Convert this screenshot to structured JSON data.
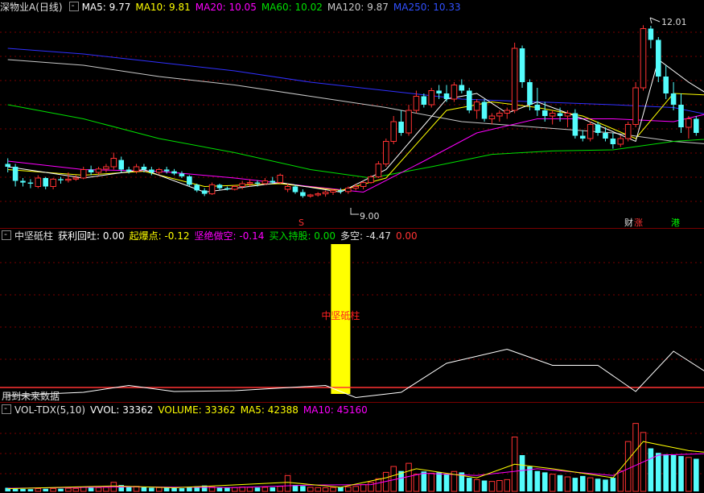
{
  "header_main": {
    "title": "深物业A(日线)",
    "ma5_label": "MA5: 9.77",
    "ma10_label": "MA10: 9.81",
    "ma20_label": "MA20: 10.05",
    "ma60_label": "MA60: 10.02",
    "ma120_label": "MA120: 9.87",
    "ma250_label": "MA250: 10.33"
  },
  "header_indicator": {
    "title": "中坚砥柱",
    "profit_label": "获利回吐: 0.00",
    "start_label": "起爆点: -0.12",
    "short_label": "坚绝做空: -0.14",
    "hold_label": "买入持股: 0.00",
    "longshort_label": "多空: -4.47",
    "extra_label": "0.00"
  },
  "header_volume": {
    "title": "VOL-TDX(5,10)",
    "vvol_label": "VVOL: 33362",
    "volume_label": "VOLUME: 33362",
    "ma5_label": "MA5: 42388",
    "ma10_label": "MA10: 45160"
  },
  "annotations": {
    "high_price": "12.01",
    "low_price": "9.00",
    "bar_label": "中坚砥柱",
    "future_note": "用到未来数据",
    "event_cai": "财",
    "event_zhang": "涨",
    "event_gang": "港",
    "event_s": "S"
  },
  "colors": {
    "up": "#ff3232",
    "down": "#54fcfc",
    "ma5": "#ffffff",
    "ma10": "#ffff00",
    "ma20": "#ff00ff",
    "ma60": "#00e000",
    "ma120": "#c8c8c8",
    "ma250": "#3030ff",
    "highlight": "#ffff00"
  },
  "chart_data": [
    {
      "type": "candlestick",
      "price_range": [
        8.6,
        12.2
      ],
      "candles": [
        {
          "o": 9.55,
          "h": 9.65,
          "l": 9.4,
          "c": 9.5
        },
        {
          "o": 9.5,
          "h": 9.55,
          "l": 9.15,
          "c": 9.25
        },
        {
          "o": 9.25,
          "h": 9.3,
          "l": 9.15,
          "c": 9.22
        },
        {
          "o": 9.22,
          "h": 9.28,
          "l": 9.12,
          "c": 9.2
        },
        {
          "o": 9.15,
          "h": 9.35,
          "l": 9.12,
          "c": 9.3
        },
        {
          "o": 9.3,
          "h": 9.32,
          "l": 9.1,
          "c": 9.15
        },
        {
          "o": 9.15,
          "h": 9.3,
          "l": 9.1,
          "c": 9.28
        },
        {
          "o": 9.28,
          "h": 9.32,
          "l": 9.2,
          "c": 9.26
        },
        {
          "o": 9.26,
          "h": 9.4,
          "l": 9.22,
          "c": 9.28
        },
        {
          "o": 9.28,
          "h": 9.35,
          "l": 9.25,
          "c": 9.3
        },
        {
          "o": 9.3,
          "h": 9.5,
          "l": 9.28,
          "c": 9.45
        },
        {
          "o": 9.45,
          "h": 9.52,
          "l": 9.35,
          "c": 9.4
        },
        {
          "o": 9.4,
          "h": 9.5,
          "l": 9.35,
          "c": 9.46
        },
        {
          "o": 9.46,
          "h": 9.55,
          "l": 9.4,
          "c": 9.5
        },
        {
          "o": 9.5,
          "h": 9.75,
          "l": 9.45,
          "c": 9.65
        },
        {
          "o": 9.62,
          "h": 9.68,
          "l": 9.4,
          "c": 9.45
        },
        {
          "o": 9.45,
          "h": 9.5,
          "l": 9.38,
          "c": 9.42
        },
        {
          "o": 9.42,
          "h": 9.55,
          "l": 9.38,
          "c": 9.5
        },
        {
          "o": 9.5,
          "h": 9.55,
          "l": 9.4,
          "c": 9.45
        },
        {
          "o": 9.45,
          "h": 9.5,
          "l": 9.35,
          "c": 9.4
        },
        {
          "o": 9.4,
          "h": 9.48,
          "l": 9.36,
          "c": 9.45
        },
        {
          "o": 9.45,
          "h": 9.5,
          "l": 9.38,
          "c": 9.42
        },
        {
          "o": 9.42,
          "h": 9.46,
          "l": 9.35,
          "c": 9.38
        },
        {
          "o": 9.38,
          "h": 9.42,
          "l": 9.3,
          "c": 9.33
        },
        {
          "o": 9.33,
          "h": 9.35,
          "l": 9.15,
          "c": 9.18
        },
        {
          "o": 9.18,
          "h": 9.2,
          "l": 9.05,
          "c": 9.08
        },
        {
          "o": 9.08,
          "h": 9.12,
          "l": 8.98,
          "c": 9.02
        },
        {
          "o": 9.02,
          "h": 9.22,
          "l": 9.0,
          "c": 9.18
        },
        {
          "o": 9.18,
          "h": 9.2,
          "l": 9.08,
          "c": 9.12
        },
        {
          "o": 9.12,
          "h": 9.15,
          "l": 9.08,
          "c": 9.1
        },
        {
          "o": 9.1,
          "h": 9.18,
          "l": 9.08,
          "c": 9.15
        },
        {
          "o": 9.15,
          "h": 9.25,
          "l": 9.1,
          "c": 9.2
        },
        {
          "o": 9.2,
          "h": 9.28,
          "l": 9.15,
          "c": 9.22
        },
        {
          "o": 9.22,
          "h": 9.26,
          "l": 9.15,
          "c": 9.2
        },
        {
          "o": 9.2,
          "h": 9.3,
          "l": 9.18,
          "c": 9.25
        },
        {
          "o": 9.25,
          "h": 9.32,
          "l": 9.2,
          "c": 9.22
        },
        {
          "o": 9.22,
          "h": 9.38,
          "l": 9.2,
          "c": 9.35
        },
        {
          "o": 9.1,
          "h": 9.2,
          "l": 9.05,
          "c": 9.15
        },
        {
          "o": 9.15,
          "h": 9.18,
          "l": 9.02,
          "c": 9.05
        },
        {
          "o": 9.05,
          "h": 9.1,
          "l": 8.95,
          "c": 8.98
        },
        {
          "o": 8.98,
          "h": 9.02,
          "l": 8.95,
          "c": 9.0
        },
        {
          "o": 9.0,
          "h": 9.05,
          "l": 8.97,
          "c": 9.02
        },
        {
          "o": 9.02,
          "h": 9.08,
          "l": 8.97,
          "c": 9.05
        },
        {
          "o": 9.05,
          "h": 9.1,
          "l": 9.0,
          "c": 9.08
        },
        {
          "o": 9.08,
          "h": 9.12,
          "l": 9.02,
          "c": 9.06
        },
        {
          "o": 9.06,
          "h": 9.15,
          "l": 9.02,
          "c": 9.12
        },
        {
          "o": 9.12,
          "h": 9.2,
          "l": 9.08,
          "c": 9.15
        },
        {
          "o": 9.15,
          "h": 9.25,
          "l": 9.1,
          "c": 9.22
        },
        {
          "o": 9.22,
          "h": 9.35,
          "l": 9.2,
          "c": 9.32
        },
        {
          "o": 9.32,
          "h": 9.6,
          "l": 9.3,
          "c": 9.55
        },
        {
          "o": 9.55,
          "h": 10.0,
          "l": 9.5,
          "c": 9.95
        },
        {
          "o": 9.95,
          "h": 10.4,
          "l": 9.9,
          "c": 10.3
        },
        {
          "o": 10.3,
          "h": 10.5,
          "l": 10.05,
          "c": 10.1
        },
        {
          "o": 10.1,
          "h": 10.6,
          "l": 10.05,
          "c": 10.5
        },
        {
          "o": 10.5,
          "h": 10.85,
          "l": 10.45,
          "c": 10.75
        },
        {
          "o": 10.75,
          "h": 10.8,
          "l": 10.55,
          "c": 10.6
        },
        {
          "o": 10.6,
          "h": 10.9,
          "l": 10.55,
          "c": 10.85
        },
        {
          "o": 10.85,
          "h": 10.95,
          "l": 10.7,
          "c": 10.8
        },
        {
          "o": 10.8,
          "h": 10.95,
          "l": 10.65,
          "c": 10.7
        },
        {
          "o": 10.7,
          "h": 11.0,
          "l": 10.65,
          "c": 10.95
        },
        {
          "o": 10.95,
          "h": 11.05,
          "l": 10.8,
          "c": 10.85
        },
        {
          "o": 10.85,
          "h": 10.9,
          "l": 10.45,
          "c": 10.5
        },
        {
          "o": 10.5,
          "h": 10.7,
          "l": 10.35,
          "c": 10.65
        },
        {
          "o": 10.65,
          "h": 10.7,
          "l": 10.3,
          "c": 10.35
        },
        {
          "o": 10.35,
          "h": 10.45,
          "l": 10.25,
          "c": 10.4
        },
        {
          "o": 10.4,
          "h": 10.5,
          "l": 10.3,
          "c": 10.45
        },
        {
          "o": 10.45,
          "h": 10.55,
          "l": 10.35,
          "c": 10.5
        },
        {
          "o": 10.5,
          "h": 11.7,
          "l": 10.45,
          "c": 11.6
        },
        {
          "o": 11.6,
          "h": 11.65,
          "l": 10.9,
          "c": 11.0
        },
        {
          "o": 11.0,
          "h": 11.05,
          "l": 10.5,
          "c": 10.6
        },
        {
          "o": 10.6,
          "h": 10.9,
          "l": 10.4,
          "c": 10.5
        },
        {
          "o": 10.5,
          "h": 10.65,
          "l": 10.3,
          "c": 10.4
        },
        {
          "o": 10.4,
          "h": 10.5,
          "l": 10.25,
          "c": 10.45
        },
        {
          "o": 10.45,
          "h": 10.55,
          "l": 10.3,
          "c": 10.4
        },
        {
          "o": 10.4,
          "h": 10.5,
          "l": 10.2,
          "c": 10.45
        },
        {
          "o": 10.45,
          "h": 10.52,
          "l": 10.0,
          "c": 10.05
        },
        {
          "o": 10.05,
          "h": 10.15,
          "l": 9.95,
          "c": 10.0
        },
        {
          "o": 10.0,
          "h": 10.3,
          "l": 9.95,
          "c": 10.25
        },
        {
          "o": 10.25,
          "h": 10.3,
          "l": 10.05,
          "c": 10.1
        },
        {
          "o": 10.1,
          "h": 10.2,
          "l": 9.95,
          "c": 10.0
        },
        {
          "o": 10.0,
          "h": 10.1,
          "l": 9.82,
          "c": 9.9
        },
        {
          "o": 9.9,
          "h": 10.05,
          "l": 9.85,
          "c": 10.0
        },
        {
          "o": 10.0,
          "h": 10.3,
          "l": 9.95,
          "c": 10.25
        },
        {
          "o": 10.25,
          "h": 11.0,
          "l": 10.2,
          "c": 10.9
        },
        {
          "o": 10.9,
          "h": 12.01,
          "l": 10.85,
          "c": 11.95
        },
        {
          "o": 11.95,
          "h": 12.0,
          "l": 11.6,
          "c": 11.75
        },
        {
          "o": 11.75,
          "h": 11.8,
          "l": 11.0,
          "c": 11.1
        },
        {
          "o": 11.1,
          "h": 11.3,
          "l": 10.7,
          "c": 10.8
        },
        {
          "o": 10.8,
          "h": 11.0,
          "l": 10.5,
          "c": 10.6
        },
        {
          "o": 10.6,
          "h": 10.8,
          "l": 10.1,
          "c": 10.2
        },
        {
          "o": 10.2,
          "h": 10.4,
          "l": 10.0,
          "c": 10.35
        },
        {
          "o": 10.35,
          "h": 10.4,
          "l": 10.05,
          "c": 10.1
        }
      ],
      "moving_averages": {
        "ma5": [
          [
            0,
            9.5
          ],
          [
            10,
            9.3
          ],
          [
            18,
            9.45
          ],
          [
            26,
            9.05
          ],
          [
            36,
            9.22
          ],
          [
            44,
            9.05
          ],
          [
            50,
            9.45
          ],
          [
            58,
            10.7
          ],
          [
            62,
            10.8
          ],
          [
            66,
            10.45
          ],
          [
            70,
            10.65
          ],
          [
            76,
            10.35
          ],
          [
            83,
            9.95
          ],
          [
            86,
            11.4
          ],
          [
            90,
            11.0
          ],
          [
            96,
            10.5
          ]
        ],
        "ma10": [
          [
            0,
            9.45
          ],
          [
            10,
            9.35
          ],
          [
            18,
            9.42
          ],
          [
            26,
            9.15
          ],
          [
            36,
            9.2
          ],
          [
            44,
            9.08
          ],
          [
            50,
            9.3
          ],
          [
            58,
            10.5
          ],
          [
            64,
            10.65
          ],
          [
            70,
            10.55
          ],
          [
            76,
            10.4
          ],
          [
            83,
            10.0
          ],
          [
            88,
            10.8
          ],
          [
            96,
            10.75
          ]
        ],
        "ma20": [
          [
            0,
            9.6
          ],
          [
            10,
            9.45
          ],
          [
            20,
            9.42
          ],
          [
            30,
            9.3
          ],
          [
            40,
            9.15
          ],
          [
            47,
            9.05
          ],
          [
            55,
            9.6
          ],
          [
            62,
            10.1
          ],
          [
            70,
            10.35
          ],
          [
            80,
            10.35
          ],
          [
            88,
            10.3
          ],
          [
            96,
            10.55
          ]
        ],
        "ma60": [
          [
            0,
            10.6
          ],
          [
            10,
            10.35
          ],
          [
            20,
            10.0
          ],
          [
            30,
            9.75
          ],
          [
            40,
            9.45
          ],
          [
            48,
            9.3
          ],
          [
            56,
            9.5
          ],
          [
            64,
            9.72
          ],
          [
            72,
            9.78
          ],
          [
            80,
            9.8
          ],
          [
            88,
            9.95
          ],
          [
            96,
            10.02
          ]
        ],
        "ma120": [
          [
            0,
            11.4
          ],
          [
            10,
            11.3
          ],
          [
            20,
            11.1
          ],
          [
            30,
            10.95
          ],
          [
            40,
            10.75
          ],
          [
            50,
            10.55
          ],
          [
            60,
            10.3
          ],
          [
            70,
            10.2
          ],
          [
            80,
            10.1
          ],
          [
            88,
            9.95
          ],
          [
            96,
            9.87
          ]
        ],
        "ma250": [
          [
            0,
            11.6
          ],
          [
            10,
            11.5
          ],
          [
            20,
            11.35
          ],
          [
            30,
            11.2
          ],
          [
            40,
            11.0
          ],
          [
            50,
            10.85
          ],
          [
            60,
            10.7
          ],
          [
            70,
            10.65
          ],
          [
            80,
            10.6
          ],
          [
            88,
            10.55
          ],
          [
            96,
            10.33
          ]
        ]
      }
    },
    {
      "type": "line",
      "signal_bar_index": 44,
      "values": [
        [
          0,
          -0.2
        ],
        [
          10,
          -0.12
        ],
        [
          16,
          0.05
        ],
        [
          22,
          -0.1
        ],
        [
          30,
          -0.08
        ],
        [
          42,
          0.05
        ],
        [
          46,
          -0.25
        ],
        [
          52,
          -0.12
        ],
        [
          58,
          0.6
        ],
        [
          66,
          0.95
        ],
        [
          72,
          0.55
        ],
        [
          78,
          0.55
        ],
        [
          83,
          -0.1
        ],
        [
          88,
          0.9
        ],
        [
          93,
          0.3
        ],
        [
          96,
          -0.05
        ]
      ]
    },
    {
      "type": "bar",
      "max_volume": 160000,
      "volumes": [
        8000,
        6000,
        5500,
        5000,
        6200,
        5800,
        6500,
        6000,
        7000,
        6500,
        9000,
        8000,
        8500,
        9000,
        20000,
        14000,
        10000,
        11000,
        9000,
        8000,
        8500,
        8000,
        7500,
        7000,
        9500,
        11000,
        13000,
        10000,
        9000,
        8000,
        8500,
        9500,
        9000,
        8500,
        9000,
        9000,
        11000,
        35000,
        14000,
        12000,
        9000,
        8500,
        8000,
        8500,
        9000,
        10000,
        11000,
        15000,
        20000,
        28000,
        42000,
        55000,
        45000,
        62000,
        38000,
        44000,
        40000,
        42000,
        38000,
        44000,
        42000,
        30000,
        26000,
        24000,
        22000,
        24000,
        26000,
        120000,
        80000,
        55000,
        45000,
        42000,
        38000,
        36000,
        32000,
        30000,
        34000,
        30000,
        28000,
        26000,
        30000,
        45000,
        110000,
        150000,
        130000,
        95000,
        85000,
        82000,
        80000,
        78000,
        75000,
        72000
      ],
      "ma5": [
        [
          0,
          6000
        ],
        [
          14,
          12000
        ],
        [
          22,
          8000
        ],
        [
          37,
          20000
        ],
        [
          44,
          9000
        ],
        [
          50,
          30000
        ],
        [
          54,
          50000
        ],
        [
          62,
          30000
        ],
        [
          67,
          60000
        ],
        [
          72,
          50000
        ],
        [
          80,
          30000
        ],
        [
          84,
          110000
        ],
        [
          90,
          90000
        ],
        [
          96,
          80000
        ]
      ],
      "ma10": [
        [
          0,
          7000
        ],
        [
          16,
          10000
        ],
        [
          30,
          8500
        ],
        [
          40,
          14000
        ],
        [
          48,
          15000
        ],
        [
          55,
          40000
        ],
        [
          62,
          35000
        ],
        [
          70,
          50000
        ],
        [
          80,
          35000
        ],
        [
          86,
          80000
        ],
        [
          96,
          85000
        ]
      ]
    }
  ]
}
